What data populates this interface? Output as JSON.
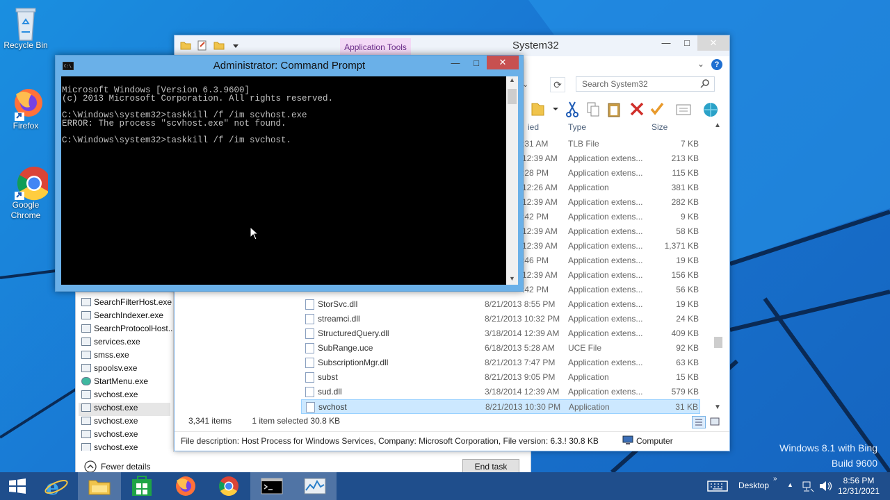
{
  "desktop": {
    "icons": [
      {
        "label": "Recycle Bin"
      },
      {
        "label": "Firefox"
      },
      {
        "label": "Google Chrome"
      }
    ],
    "watermark_line1": "Windows 8.1 with Bing",
    "watermark_line2": "Build 9600"
  },
  "explorer": {
    "title": "System32",
    "ribbon_context_tab": "Application Tools",
    "search_placeholder": "Search System32",
    "columns": {
      "date": "ied",
      "type": "Type",
      "size": "Size"
    },
    "files": [
      {
        "name": "",
        "date": ":31 AM",
        "type": "TLB File",
        "size": "7 KB"
      },
      {
        "name": "",
        "date": "12:39 AM",
        "type": "Application extens...",
        "size": "213 KB"
      },
      {
        "name": "",
        "date": ":28 PM",
        "type": "Application extens...",
        "size": "115 KB"
      },
      {
        "name": "",
        "date": "12:26 AM",
        "type": "Application",
        "size": "381 KB"
      },
      {
        "name": "",
        "date": "12:39 AM",
        "type": "Application extens...",
        "size": "282 KB"
      },
      {
        "name": "",
        "date": ":42 PM",
        "type": "Application extens...",
        "size": "9 KB"
      },
      {
        "name": "",
        "date": "12:39 AM",
        "type": "Application extens...",
        "size": "58 KB"
      },
      {
        "name": "",
        "date": "12:39 AM",
        "type": "Application extens...",
        "size": "1,371 KB"
      },
      {
        "name": "",
        "date": ":46 PM",
        "type": "Application extens...",
        "size": "19 KB"
      },
      {
        "name": "",
        "date": "12:39 AM",
        "type": "Application extens...",
        "size": "156 KB"
      },
      {
        "name": "",
        "date": ":42 PM",
        "type": "Application extens...",
        "size": "56 KB"
      },
      {
        "name": "StorSvc.dll",
        "date": "8/21/2013 8:55 PM",
        "type": "Application extens...",
        "size": "19 KB"
      },
      {
        "name": "streamci.dll",
        "date": "8/21/2013 10:32 PM",
        "type": "Application extens...",
        "size": "24 KB"
      },
      {
        "name": "StructuredQuery.dll",
        "date": "3/18/2014 12:39 AM",
        "type": "Application extens...",
        "size": "409 KB"
      },
      {
        "name": "SubRange.uce",
        "date": "6/18/2013 5:28 AM",
        "type": "UCE File",
        "size": "92 KB"
      },
      {
        "name": "SubscriptionMgr.dll",
        "date": "8/21/2013 7:47 PM",
        "type": "Application extens...",
        "size": "63 KB"
      },
      {
        "name": "subst",
        "date": "8/21/2013 9:05 PM",
        "type": "Application",
        "size": "15 KB"
      },
      {
        "name": "sud.dll",
        "date": "3/18/2014 12:39 AM",
        "type": "Application extens...",
        "size": "579 KB"
      },
      {
        "name": "svchost",
        "date": "8/21/2013 10:30 PM",
        "type": "Application",
        "size": "31 KB"
      }
    ],
    "status_items": "3,341 items",
    "status_selected": "1 item selected  30.8 KB",
    "description": "File description: Host Process for Windows Services, Company: Microsoft Corporation, File version: 6.3.! 30.8 KB",
    "location": "Computer"
  },
  "taskmgr": {
    "processes": [
      "SearchFilterHost.exe",
      "SearchIndexer.exe",
      "SearchProtocolHost...",
      "services.exe",
      "smss.exe",
      "spoolsv.exe",
      "StartMenu.exe",
      "svchost.exe",
      "svchost.exe",
      "svchost.exe",
      "svchost.exe",
      "svchost.exe"
    ],
    "fewer_details": "Fewer details",
    "end_task": "End task"
  },
  "cmd": {
    "title": "Administrator: Command Prompt",
    "lines": [
      "Microsoft Windows [Version 6.3.9600]",
      "(c) 2013 Microsoft Corporation. All rights reserved.",
      "",
      "C:\\Windows\\system32>taskkill /f /im scvhost.exe",
      "ERROR: The process \"scvhost.exe\" not found.",
      "",
      "C:\\Windows\\system32>taskkill /f /im svchost."
    ]
  },
  "taskbar": {
    "desktop_label": "Desktop",
    "time": "8:56 PM",
    "date": "12/31/2021"
  }
}
